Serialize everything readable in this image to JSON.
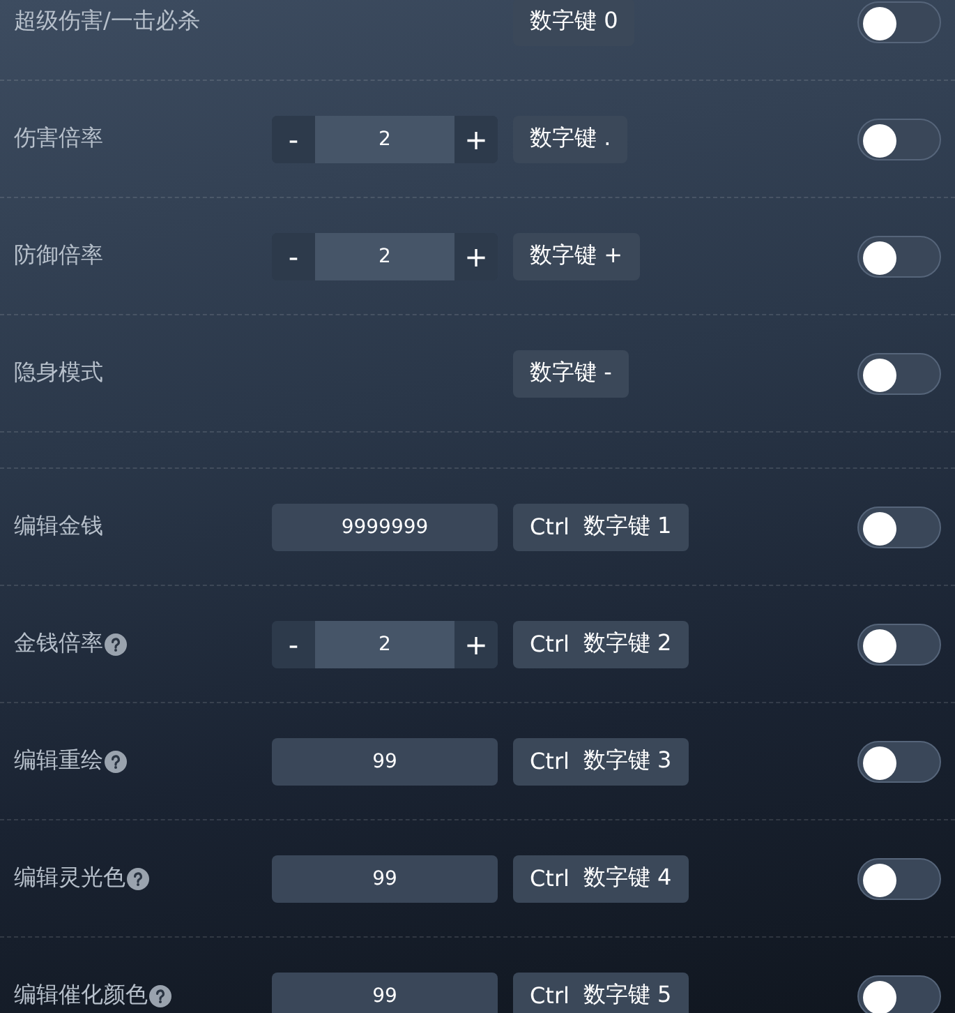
{
  "sections": [
    {
      "rows": [
        {
          "label": "超级伤害/一击必杀",
          "help": false,
          "control": {
            "kind": "none"
          },
          "hotkey": [
            "数字键 0"
          ],
          "on": false
        },
        {
          "label": "伤害倍率",
          "help": false,
          "control": {
            "kind": "stepper",
            "minus": "-",
            "value": "2",
            "plus": "+"
          },
          "hotkey": [
            "数字键 ."
          ],
          "on": false
        },
        {
          "label": "防御倍率",
          "help": false,
          "control": {
            "kind": "stepper",
            "minus": "-",
            "value": "2",
            "plus": "+"
          },
          "hotkey": [
            "数字键 +"
          ],
          "on": false
        },
        {
          "label": "隐身模式",
          "help": false,
          "control": {
            "kind": "none"
          },
          "hotkey": [
            "数字键 -"
          ],
          "on": false
        }
      ]
    },
    {
      "rows": [
        {
          "label": "编辑金钱",
          "help": false,
          "control": {
            "kind": "input",
            "value": "9999999"
          },
          "hotkey": [
            "Ctrl",
            "数字键 1"
          ],
          "on": false
        },
        {
          "label": "金钱倍率",
          "help": true,
          "control": {
            "kind": "stepper",
            "minus": "-",
            "value": "2",
            "plus": "+"
          },
          "hotkey": [
            "Ctrl",
            "数字键 2"
          ],
          "on": false
        },
        {
          "label": "编辑重绘",
          "help": true,
          "control": {
            "kind": "input",
            "value": "99"
          },
          "hotkey": [
            "Ctrl",
            "数字键 3"
          ],
          "on": false
        },
        {
          "label": "编辑灵光色",
          "help": true,
          "control": {
            "kind": "input",
            "value": "99"
          },
          "hotkey": [
            "Ctrl",
            "数字键 4"
          ],
          "on": false
        },
        {
          "label": "编辑催化颜色",
          "help": true,
          "control": {
            "kind": "input",
            "value": "99"
          },
          "hotkey": [
            "Ctrl",
            "数字键 5"
          ],
          "on": false
        }
      ]
    }
  ]
}
